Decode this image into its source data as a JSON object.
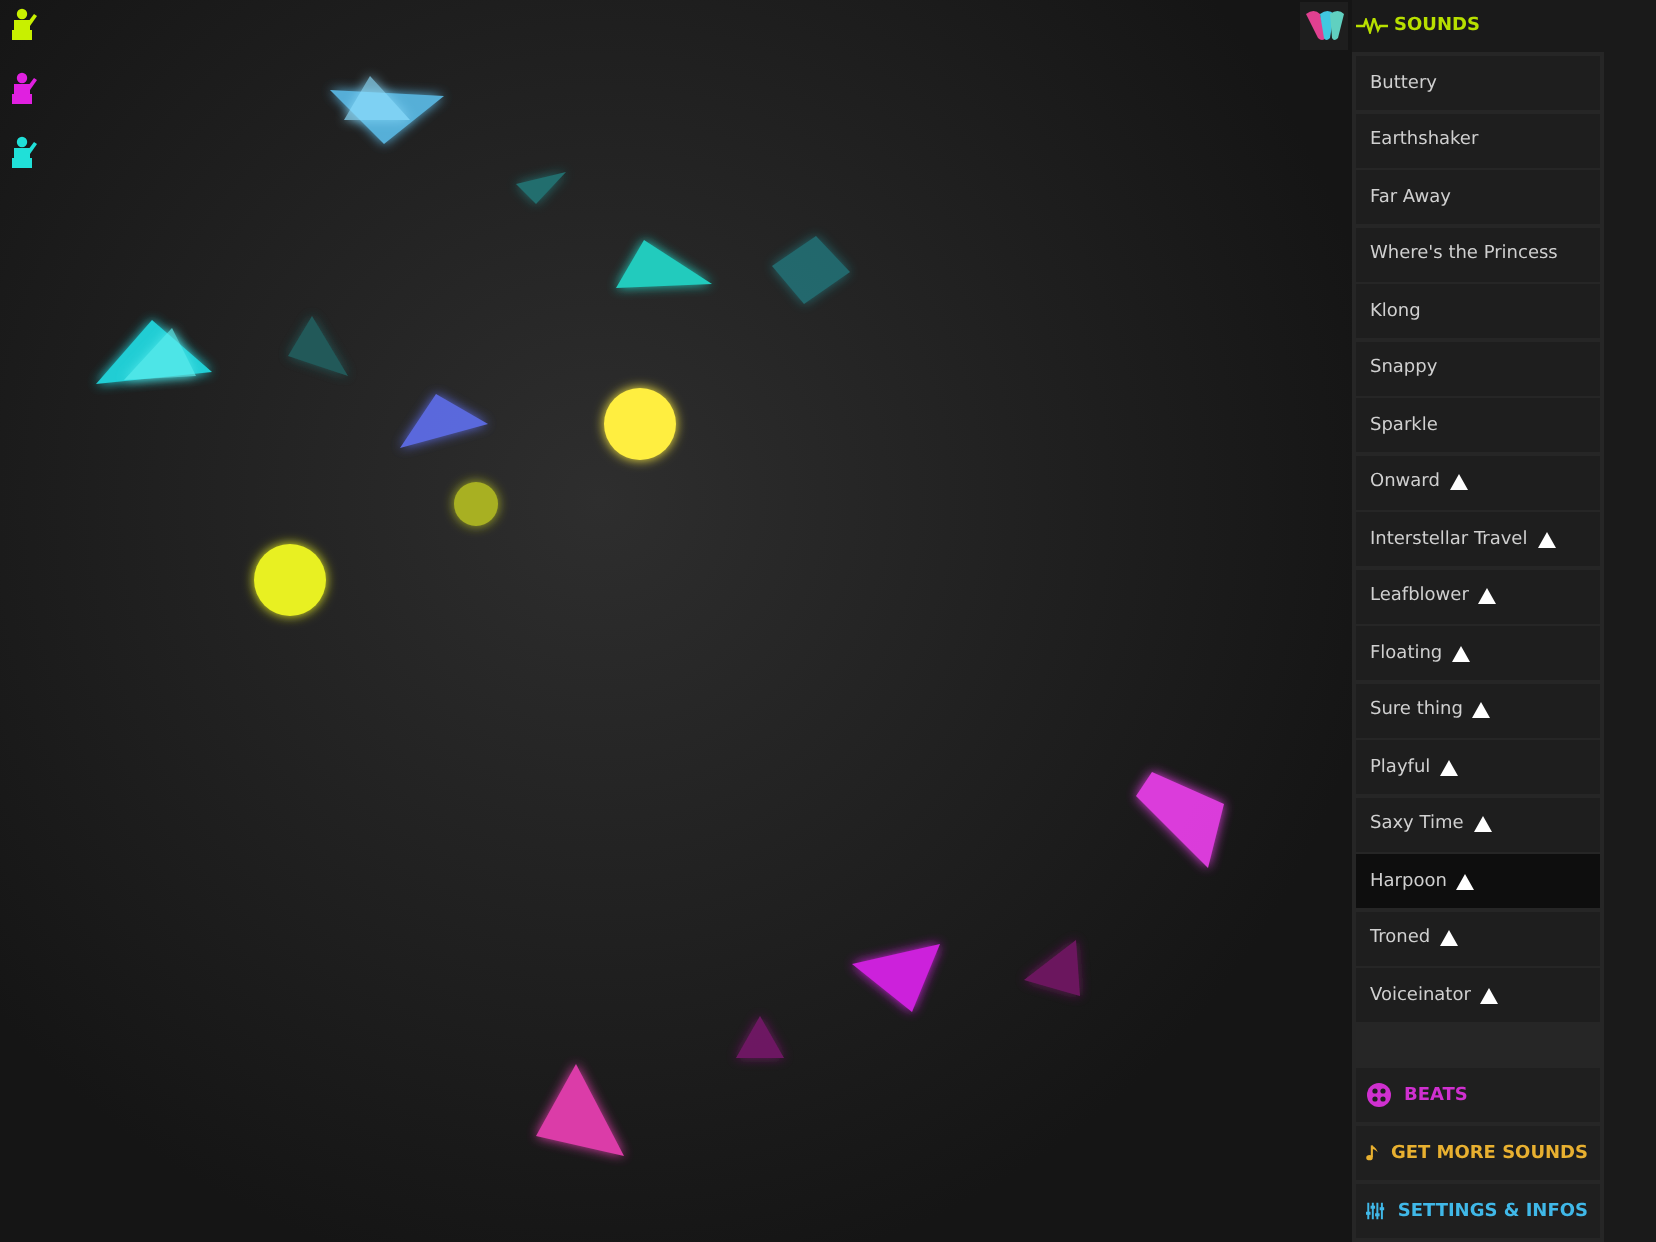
{
  "players": [
    {
      "color": "#c8f000"
    },
    {
      "color": "#e020e0"
    },
    {
      "color": "#20e0d8"
    }
  ],
  "sidebar": {
    "header": {
      "title": "SOUNDS"
    },
    "sounds": [
      {
        "label": "Buttery",
        "marked": false,
        "selected": false
      },
      {
        "label": "Earthshaker",
        "marked": false,
        "selected": false
      },
      {
        "label": "Far Away",
        "marked": false,
        "selected": false
      },
      {
        "label": "Where's the Princess",
        "marked": false,
        "selected": false
      },
      {
        "label": "Klong",
        "marked": false,
        "selected": false
      },
      {
        "label": "Snappy",
        "marked": false,
        "selected": false
      },
      {
        "label": "Sparkle",
        "marked": false,
        "selected": false
      },
      {
        "label": "Onward",
        "marked": true,
        "selected": false
      },
      {
        "label": "Interstellar Travel",
        "marked": true,
        "selected": false
      },
      {
        "label": "Leafblower",
        "marked": true,
        "selected": false
      },
      {
        "label": "Floating",
        "marked": true,
        "selected": false
      },
      {
        "label": "Sure thing",
        "marked": true,
        "selected": false
      },
      {
        "label": "Playful",
        "marked": true,
        "selected": false
      },
      {
        "label": "Saxy Time",
        "marked": true,
        "selected": false
      },
      {
        "label": "Harpoon",
        "marked": true,
        "selected": true
      },
      {
        "label": "Troned",
        "marked": true,
        "selected": false
      },
      {
        "label": "Voiceinator",
        "marked": true,
        "selected": false
      }
    ],
    "menu": [
      {
        "kind": "beats",
        "label": "BEATS",
        "color": "#d030d0"
      },
      {
        "kind": "store",
        "label": "GET MORE SOUNDS",
        "color": "#e8b030"
      },
      {
        "kind": "settings",
        "label": "SETTINGS & INFOS",
        "color": "#40b8e8"
      }
    ]
  }
}
